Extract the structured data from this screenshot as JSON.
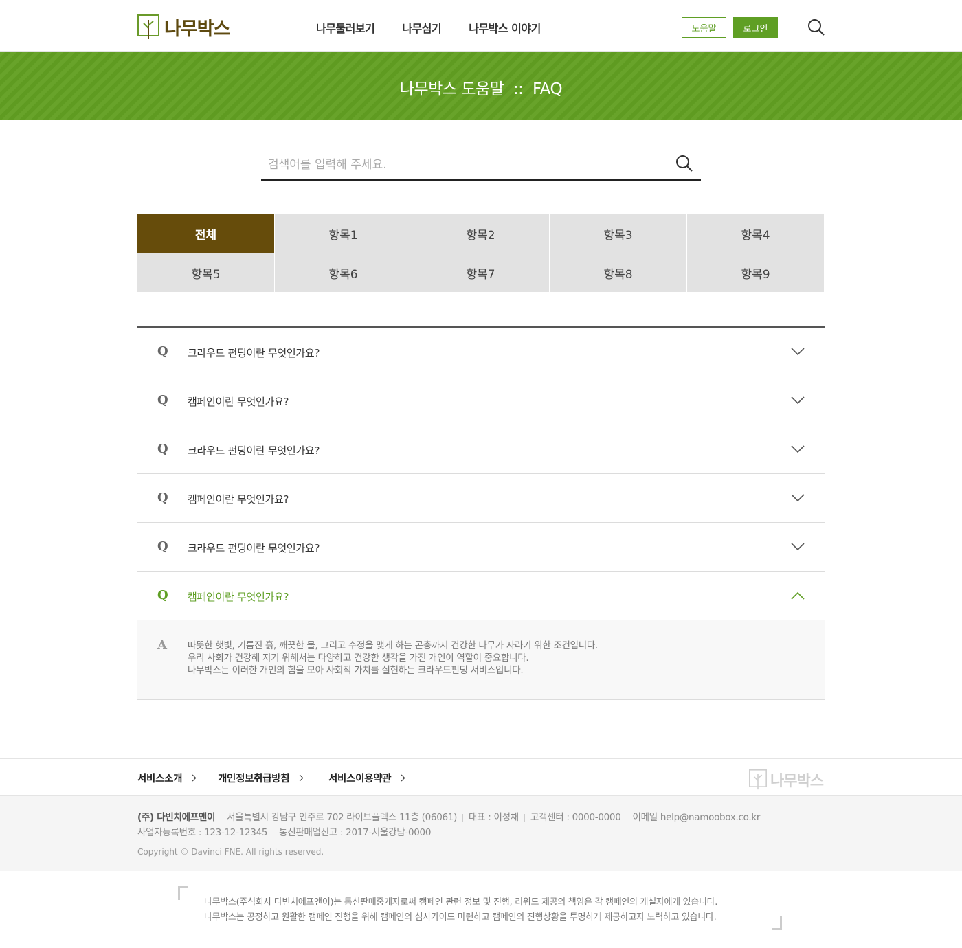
{
  "header": {
    "logo_text": "나무박스",
    "nav": [
      "나무둘러보기",
      "나무심기",
      "나무박스 이야기"
    ],
    "help_label": "도움말",
    "login_label": "로그인"
  },
  "banner": {
    "title": "나무박스 도움말  ::  FAQ"
  },
  "search": {
    "placeholder": "검색어를 입력해 주세요."
  },
  "categories": [
    "전체",
    "항목1",
    "항목2",
    "항목3",
    "항목4",
    "항목5",
    "항목6",
    "항목7",
    "항목8",
    "항목9"
  ],
  "faq": {
    "q_marker": "Q",
    "a_marker": "A",
    "items": [
      "크라우드 펀딩이란 무엇인가요?",
      "캠페인이란 무엇인가요?",
      "크라우드 펀딩이란 무엇인가요?",
      "캠페인이란 무엇인가요?",
      "크라우드 펀딩이란 무엇인가요?",
      "캠페인이란 무엇인가요?"
    ],
    "answer_lines": [
      "따뜻한 햇빛, 기름진 흙, 깨끗한 물, 그리고 수정을 맺게 하는 곤충까지 건강한 나무가 자라기 위한 조건입니다.",
      "우리 사회가 건강해 지기 위해서는 다양하고 건강한 생각을 가진 개인이 역할이 중요합니다.",
      "나무박스는 이러한 개인의 힘을 모아 사회적 가치를 실현하는 크라우드펀딩 서비스입니다."
    ]
  },
  "footer": {
    "links": [
      "서비스소개",
      "개인정보취급방침",
      "서비스이용약관"
    ],
    "logo_text": "나무박스",
    "company": "(주) 다빈치에프앤이",
    "address": "서울특별시 강남구 언주로 702 라이브플렉스 11층  (06061)",
    "ceo": "대표 : 이성채",
    "cs": "고객센터 : 0000-0000",
    "email": "이메일 help@namoobox.co.kr",
    "biz_no": "사업자등록번호 : 123-12-12345",
    "ecommerce_no": "통신판매업신고 : 2017-서울강남-0000",
    "copyright": "Copyright © Davinci FNE. All rights reserved.",
    "notice_line1": "나무박스(주식회사 다빈치에프앤이)는 통신판매중개자로써 캠페인 관련 정보 및 진행, 리워드 제공의 책임은 각 캠페인의 개설자에게 있습니다.",
    "notice_line2": "나무박스는 공정하고 원활한 캠페인 진행을 위해 캠페인의 심사가이드 마련하고 캠페인의 진행상황을 투명하게 제공하고자 노력하고 있습니다."
  },
  "colors": {
    "brand_green": "#5f9f24",
    "brand_brown": "#664c0b"
  }
}
